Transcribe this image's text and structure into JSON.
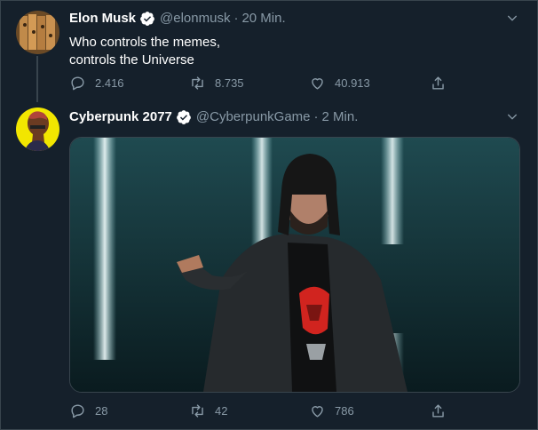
{
  "tweets": [
    {
      "name": "Elon Musk",
      "handle": "@elonmusk",
      "separator": "·",
      "time": "20 Min.",
      "text": "Who controls the memes,\ncontrols the Universe",
      "replies": "2.416",
      "retweets": "8.735",
      "likes": "40.913"
    },
    {
      "name": "Cyberpunk 2077",
      "handle": "@CyberpunkGame",
      "separator": "·",
      "time": "2 Min.",
      "replies": "28",
      "retweets": "42",
      "likes": "786"
    }
  ],
  "icons": [
    "verified-badge-icon",
    "chevron-down-icon",
    "reply-icon",
    "retweet-icon",
    "like-icon",
    "share-icon"
  ],
  "colors": {
    "background": "#15202b",
    "secondary_text": "#8899a6",
    "border": "#38444d",
    "verified": "#ffffff"
  }
}
